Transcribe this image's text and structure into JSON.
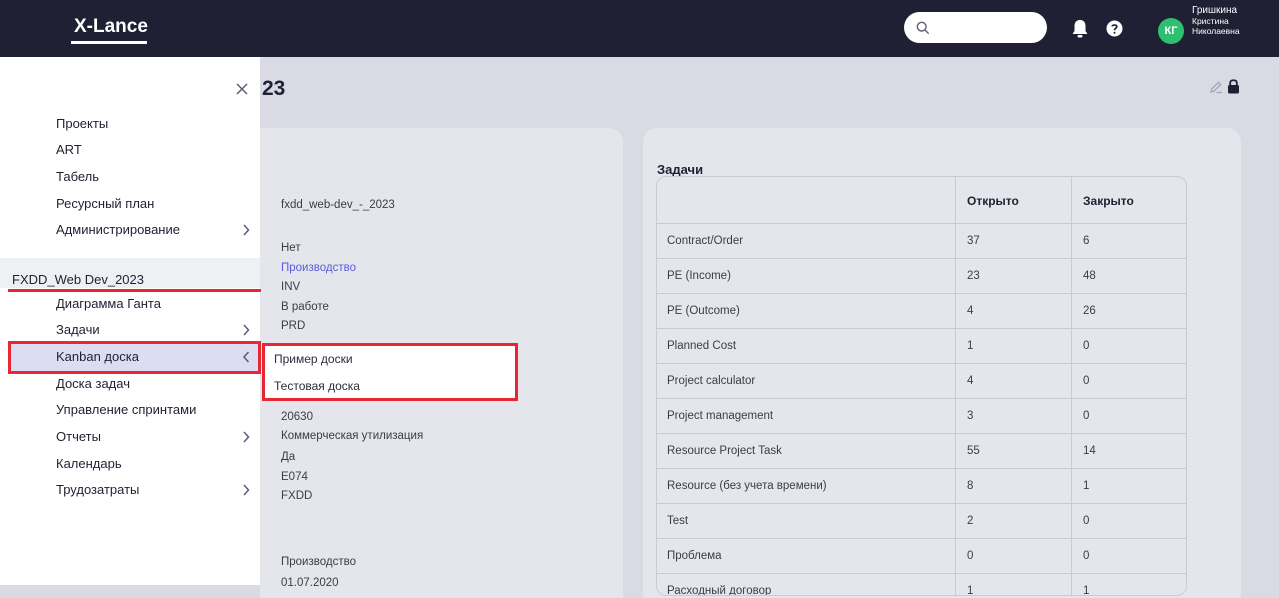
{
  "app": {
    "logo": "X-Lance",
    "search_placeholder": "",
    "avatar_initials": "КГ",
    "user": [
      "Гришкина",
      "Кристина",
      "Николаевна"
    ]
  },
  "page": {
    "title_fragment": "23"
  },
  "sidebar": {
    "top_items": [
      "Проекты",
      "ART",
      "Табель",
      "Ресурсный план",
      "Администрирование"
    ],
    "project_title": "FXDD_Web Dev_2023",
    "project_items": [
      "Диаграмма Ганта",
      "Задачи",
      "Kanban доска",
      "Доска задач",
      "Управление спринтами",
      "Отчеты",
      "Календарь",
      "Трудозатраты"
    ]
  },
  "kanban_popup": [
    "Пример доски",
    "Тестовая доска"
  ],
  "info": [
    "fxdd_web-dev_-_2023",
    "Нет",
    "Производство",
    "INV",
    "В работе",
    "PRD",
    "20630",
    "Коммерческая утилизация",
    "Да",
    "E074",
    "FXDD",
    "Производство",
    "01.07.2020"
  ],
  "tasks": {
    "title": "Задачи",
    "columns": [
      "",
      "Открыто",
      "Закрыто"
    ],
    "rows": [
      [
        "Contract/Order",
        "37",
        "6"
      ],
      [
        "PE (Income)",
        "23",
        "48"
      ],
      [
        "PE (Outcome)",
        "4",
        "26"
      ],
      [
        "Planned Cost",
        "1",
        "0"
      ],
      [
        "Project calculator",
        "4",
        "0"
      ],
      [
        "Project management",
        "3",
        "0"
      ],
      [
        "Resource Project Task",
        "55",
        "14"
      ],
      [
        "Resource (без учета времени)",
        "8",
        "1"
      ],
      [
        "Test",
        "2",
        "0"
      ],
      [
        "Проблема",
        "0",
        "0"
      ],
      [
        "Расходный договор",
        "1",
        "1"
      ]
    ]
  },
  "colors": {
    "topbar": "#1f2033",
    "accent_red": "#e52833",
    "avatar_green": "#2fbf71",
    "link": "#5a5bd6"
  }
}
